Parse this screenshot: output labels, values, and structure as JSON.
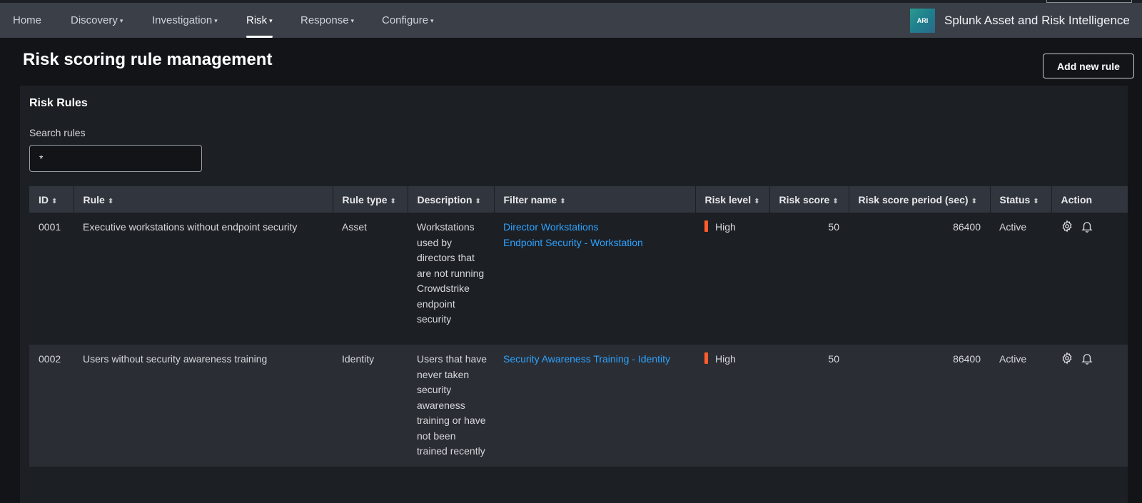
{
  "nav": {
    "items": [
      {
        "label": "Home",
        "has_caret": false
      },
      {
        "label": "Discovery",
        "has_caret": true
      },
      {
        "label": "Investigation",
        "has_caret": true
      },
      {
        "label": "Risk",
        "has_caret": true,
        "active": true
      },
      {
        "label": "Response",
        "has_caret": true
      },
      {
        "label": "Configure",
        "has_caret": true
      }
    ],
    "caret_glyph": "▾",
    "brand_logo_text": "ARI",
    "brand_name": "Splunk Asset and Risk Intelligence"
  },
  "page": {
    "title": "Risk scoring rule management",
    "add_button_label": "Add new rule"
  },
  "panel": {
    "title": "Risk Rules",
    "search_label": "Search rules",
    "search_value": "*"
  },
  "table": {
    "sort_glyph": "⬍",
    "columns": [
      "ID",
      "Rule",
      "Rule type",
      "Description",
      "Filter name",
      "Risk level",
      "Risk score",
      "Risk score period (sec)",
      "Status",
      "Action"
    ],
    "rows": [
      {
        "id": "0001",
        "rule": "Executive workstations without endpoint security",
        "rule_type": "Asset",
        "description": "Workstations used by directors that are not running Crowdstrike endpoint security",
        "filters": [
          "Director Workstations",
          "Endpoint Security - Workstation"
        ],
        "risk_level": "High",
        "risk_score": "50",
        "period": "86400",
        "status": "Active"
      },
      {
        "id": "0002",
        "rule": "Users without security awareness training",
        "rule_type": "Identity",
        "description": "Users that have never taken security awareness training or have not been trained recently",
        "filters": [
          "Security Awareness Training - Identity"
        ],
        "risk_level": "High",
        "risk_score": "50",
        "period": "86400",
        "status": "Active"
      }
    ]
  },
  "colors": {
    "topbar": "#3a3f48",
    "background": "#121418",
    "panel": "#1c1f24",
    "header_row": "#31353d",
    "link": "#2ea3ff",
    "risk_high": "#ff5c2b"
  },
  "icons": {
    "action_settings": "gear-icon",
    "action_alert": "bell-icon"
  }
}
